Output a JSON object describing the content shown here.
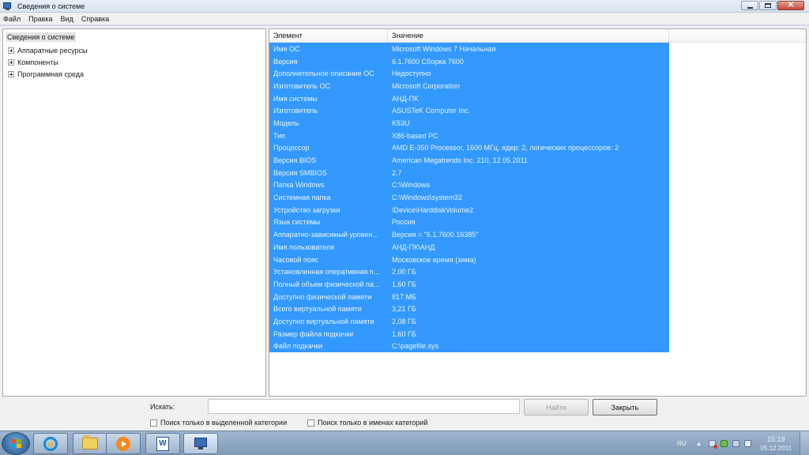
{
  "window": {
    "title": "Сведения о системе"
  },
  "menu": {
    "items": [
      "Файл",
      "Правка",
      "Вид",
      "Справка"
    ]
  },
  "tree": {
    "root": "Сведения о системе",
    "items": [
      "Аппаратные ресурсы",
      "Компоненты",
      "Программная среда"
    ]
  },
  "list": {
    "headers": {
      "element": "Элемент",
      "value": "Значение"
    },
    "rows": [
      {
        "k": "Имя ОС",
        "v": "Microsoft Windows 7 Начальная"
      },
      {
        "k": "Версия",
        "v": "6.1.7600 Сборка 7600"
      },
      {
        "k": "Дополнительное описание ОС",
        "v": "Недоступно"
      },
      {
        "k": "Изготовитель ОС",
        "v": "Microsoft Corporation"
      },
      {
        "k": "Имя системы",
        "v": "АНД-ПК"
      },
      {
        "k": "Изготовитель",
        "v": "ASUSTeK Computer Inc."
      },
      {
        "k": "Модель",
        "v": "K53U"
      },
      {
        "k": "Тип",
        "v": "X86-based PC"
      },
      {
        "k": "Процессор",
        "v": "AMD E-350 Processor, 1600 МГц, ядер: 2, логических процессоров: 2"
      },
      {
        "k": "Версия BIOS",
        "v": "American Megatrends Inc. 210, 12.05.2011"
      },
      {
        "k": "Версия SMBIOS",
        "v": "2.7"
      },
      {
        "k": "Папка Windows",
        "v": "C:\\Windows"
      },
      {
        "k": "Системная папка",
        "v": "C:\\Windows\\system32"
      },
      {
        "k": "Устройство загрузки",
        "v": "\\Device\\HarddiskVolume2"
      },
      {
        "k": "Язык системы",
        "v": "Россия"
      },
      {
        "k": "Аппаратно-зависимый уровен...",
        "v": "Версия = \"6.1.7600.16385\""
      },
      {
        "k": "Имя пользователя",
        "v": "АНД-ПК\\АНД"
      },
      {
        "k": "Часовой пояс",
        "v": "Московское время (зима)"
      },
      {
        "k": "Установленная оперативная п...",
        "v": "2,00 ГБ"
      },
      {
        "k": "Полный объем физической па...",
        "v": "1,60 ГБ"
      },
      {
        "k": "Доступно физической памяти",
        "v": "817 МБ"
      },
      {
        "k": "Всего виртуальной памяти",
        "v": "3,21 ГБ"
      },
      {
        "k": "Доступно виртуальной памяти",
        "v": "2,08 ГБ"
      },
      {
        "k": "Размер файла подкачки",
        "v": "1,60 ГБ"
      },
      {
        "k": "Файл подкачки",
        "v": "C:\\pagefile.sys"
      }
    ]
  },
  "search": {
    "label": "Искать:",
    "value": "",
    "find_label": "Найти",
    "close_label": "Закрыть",
    "chk_selected": "Поиск только в выделенной категории",
    "chk_names": "Поиск только в именах категорий"
  },
  "taskbar": {
    "lang": "RU",
    "time": "15:19",
    "date": "05.12.2011"
  },
  "colors": {
    "selection": "#3399ff",
    "taskbar": "#8fa7c1"
  }
}
